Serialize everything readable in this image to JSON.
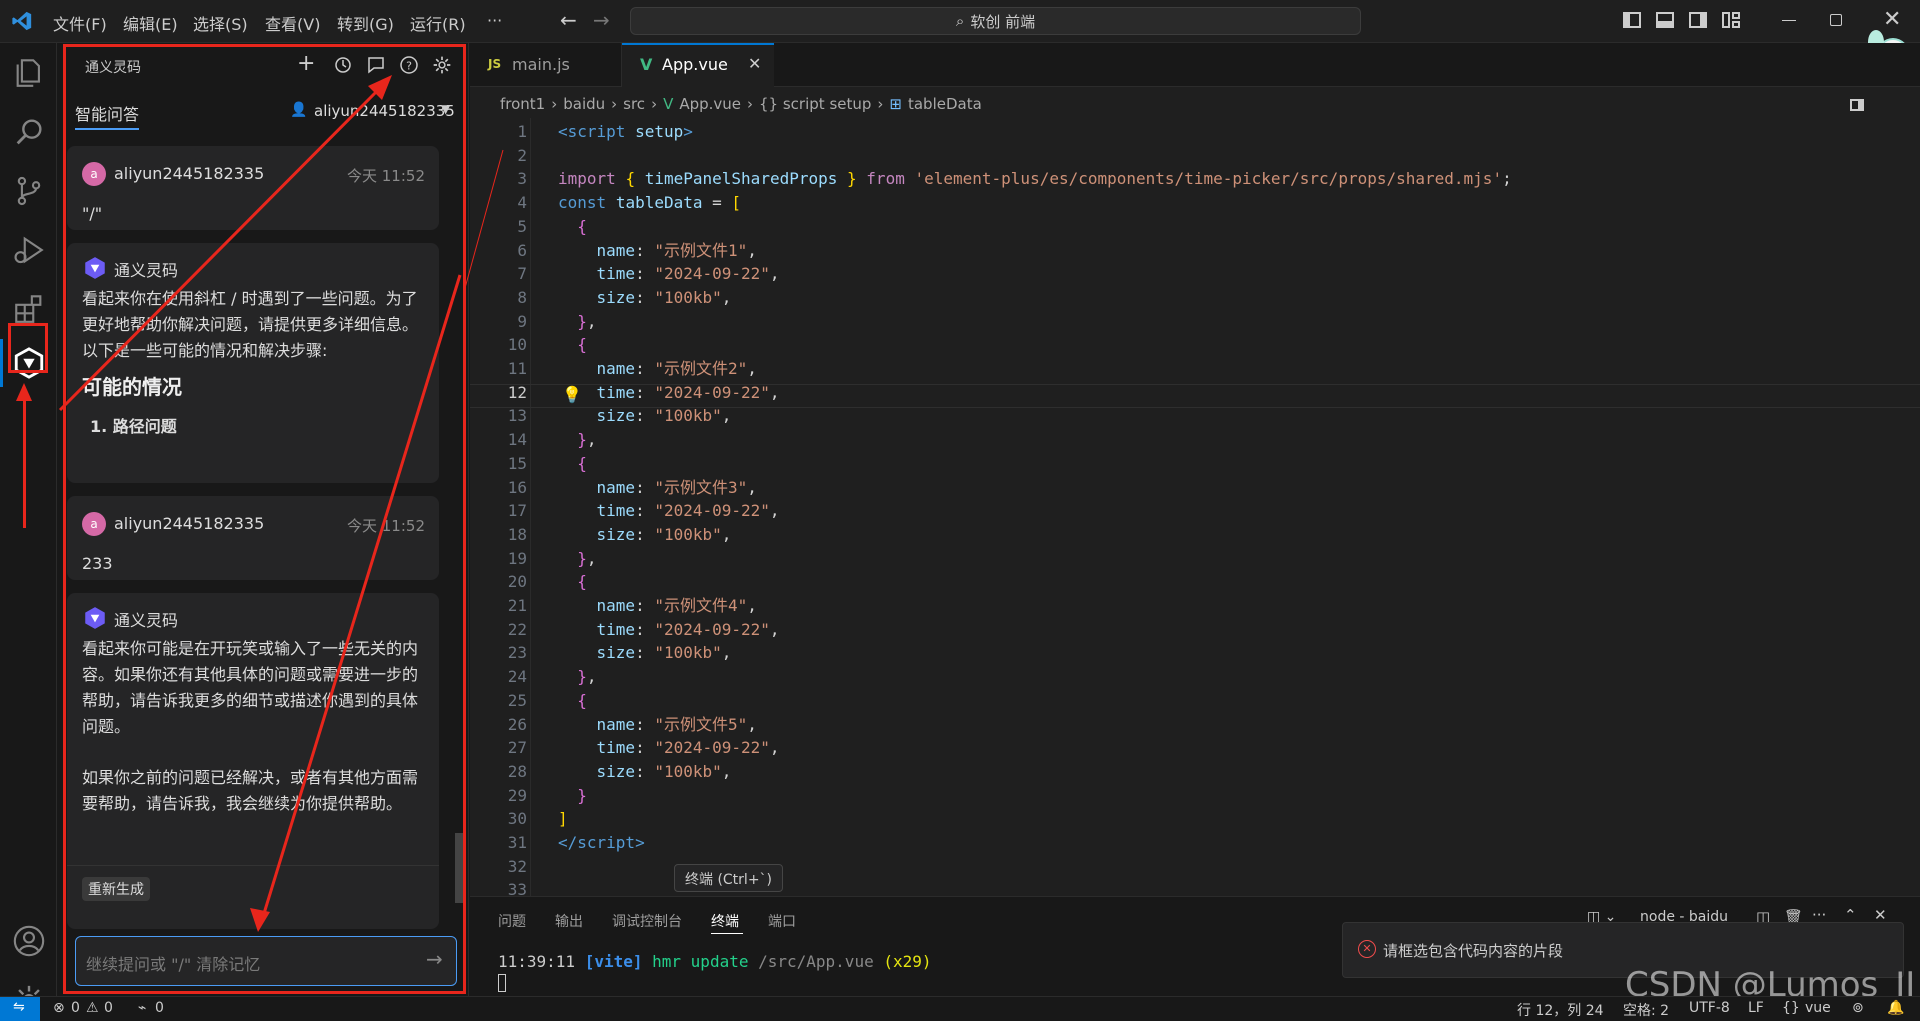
{
  "titlebar": {
    "menus": [
      "文件(F)",
      "编辑(E)",
      "选择(S)",
      "查看(V)",
      "转到(G)",
      "运行(R)",
      "···"
    ],
    "search": "软创 前端"
  },
  "chat": {
    "header_title": "通义灵码",
    "tab_label": "智能问答",
    "user_selector": "aliyun2445182335",
    "messages": [
      {
        "author": "aliyun2445182335",
        "avatar": "a",
        "time": "今天 11:52",
        "text": "\"/\""
      },
      {
        "author": "通义灵码",
        "paragraphs": [
          "看起来你在使用斜杠 / 时遇到了一些问题。为了更好地帮助你解决问题，请提供更多详细信息。以下是一些可能的情况和解决步骤:"
        ],
        "heading": "可能的情况",
        "list_item": "1. 路径问题"
      },
      {
        "author": "aliyun2445182335",
        "avatar": "a",
        "time": "今天 11:52",
        "text": "233"
      },
      {
        "author": "通义灵码",
        "paragraphs": [
          "看起来你可能是在开玩笑或输入了一些无关的内容。如果你还有其他具体的问题或需要进一步的帮助，请告诉我更多的细节或描述你遇到的具体问题。",
          "如果你之前的问题已经解决，或者有其他方面需要帮助，请告诉我，我会继续为你提供帮助。"
        ],
        "regen_label": "重新生成"
      }
    ],
    "input_placeholder": "继续提问或 \"/\" 清除记忆"
  },
  "editor": {
    "tabs": [
      {
        "label": "main.js",
        "icon": "JS",
        "active": false
      },
      {
        "label": "App.vue",
        "icon": "V",
        "active": true
      }
    ],
    "breadcrumb": [
      "front1",
      "baidu",
      "src",
      "App.vue",
      "{} script setup",
      "tableData"
    ],
    "current_line": 12,
    "line_numbers": [
      "1",
      "2",
      "3",
      "4",
      "5",
      "6",
      "7",
      "8",
      "9",
      "10",
      "11",
      "12",
      "13",
      "14",
      "15",
      "16",
      "17",
      "18",
      "19",
      "20",
      "21",
      "22",
      "23",
      "24",
      "25",
      "26",
      "27",
      "28",
      "29",
      "30",
      "31",
      "32",
      "33"
    ],
    "code": {
      "l1": "script",
      "l1b": "setup",
      "import_kw": "import",
      "import_name": "timePanelSharedProps",
      "from_kw": "from",
      "import_path": "'element-plus/es/components/time-picker/src/props/shared.mjs'",
      "const_kw": "const",
      "var_name": "tableData",
      "items": [
        {
          "name": "\"示例文件1\"",
          "time": "\"2024-09-22\"",
          "size": "\"100kb\""
        },
        {
          "name": "\"示例文件2\"",
          "time": "\"2024-09-22\"",
          "size": "\"100kb\""
        },
        {
          "name": "\"示例文件3\"",
          "time": "\"2024-09-22\"",
          "size": "\"100kb\""
        },
        {
          "name": "\"示例文件4\"",
          "time": "\"2024-09-22\"",
          "size": "\"100kb\""
        },
        {
          "name": "\"示例文件5\"",
          "time": "\"2024-09-22\"",
          "size": "\"100kb\""
        }
      ],
      "end_script": "script"
    }
  },
  "tooltip": "终端 (Ctrl+`)",
  "panel": {
    "tabs": [
      "问题",
      "输出",
      "调试控制台",
      "终端",
      "端口"
    ],
    "active_tab": "终端",
    "terminal_name": "node - baidu",
    "terminal_time": "11:39:11",
    "terminal_tag": "[vite]",
    "terminal_msg": "hmr update",
    "terminal_path": "/src/App.vue",
    "terminal_count": "(x29)"
  },
  "notification": "请框选包含代码内容的片段",
  "watermark": "CSDN @Lumos_JI",
  "status": {
    "errors": "0",
    "warnings": "0",
    "ports": "0",
    "position": "行 12，列 24",
    "spaces": "空格: 2",
    "encoding": "UTF-8",
    "eol": "LF",
    "language": "vue"
  }
}
